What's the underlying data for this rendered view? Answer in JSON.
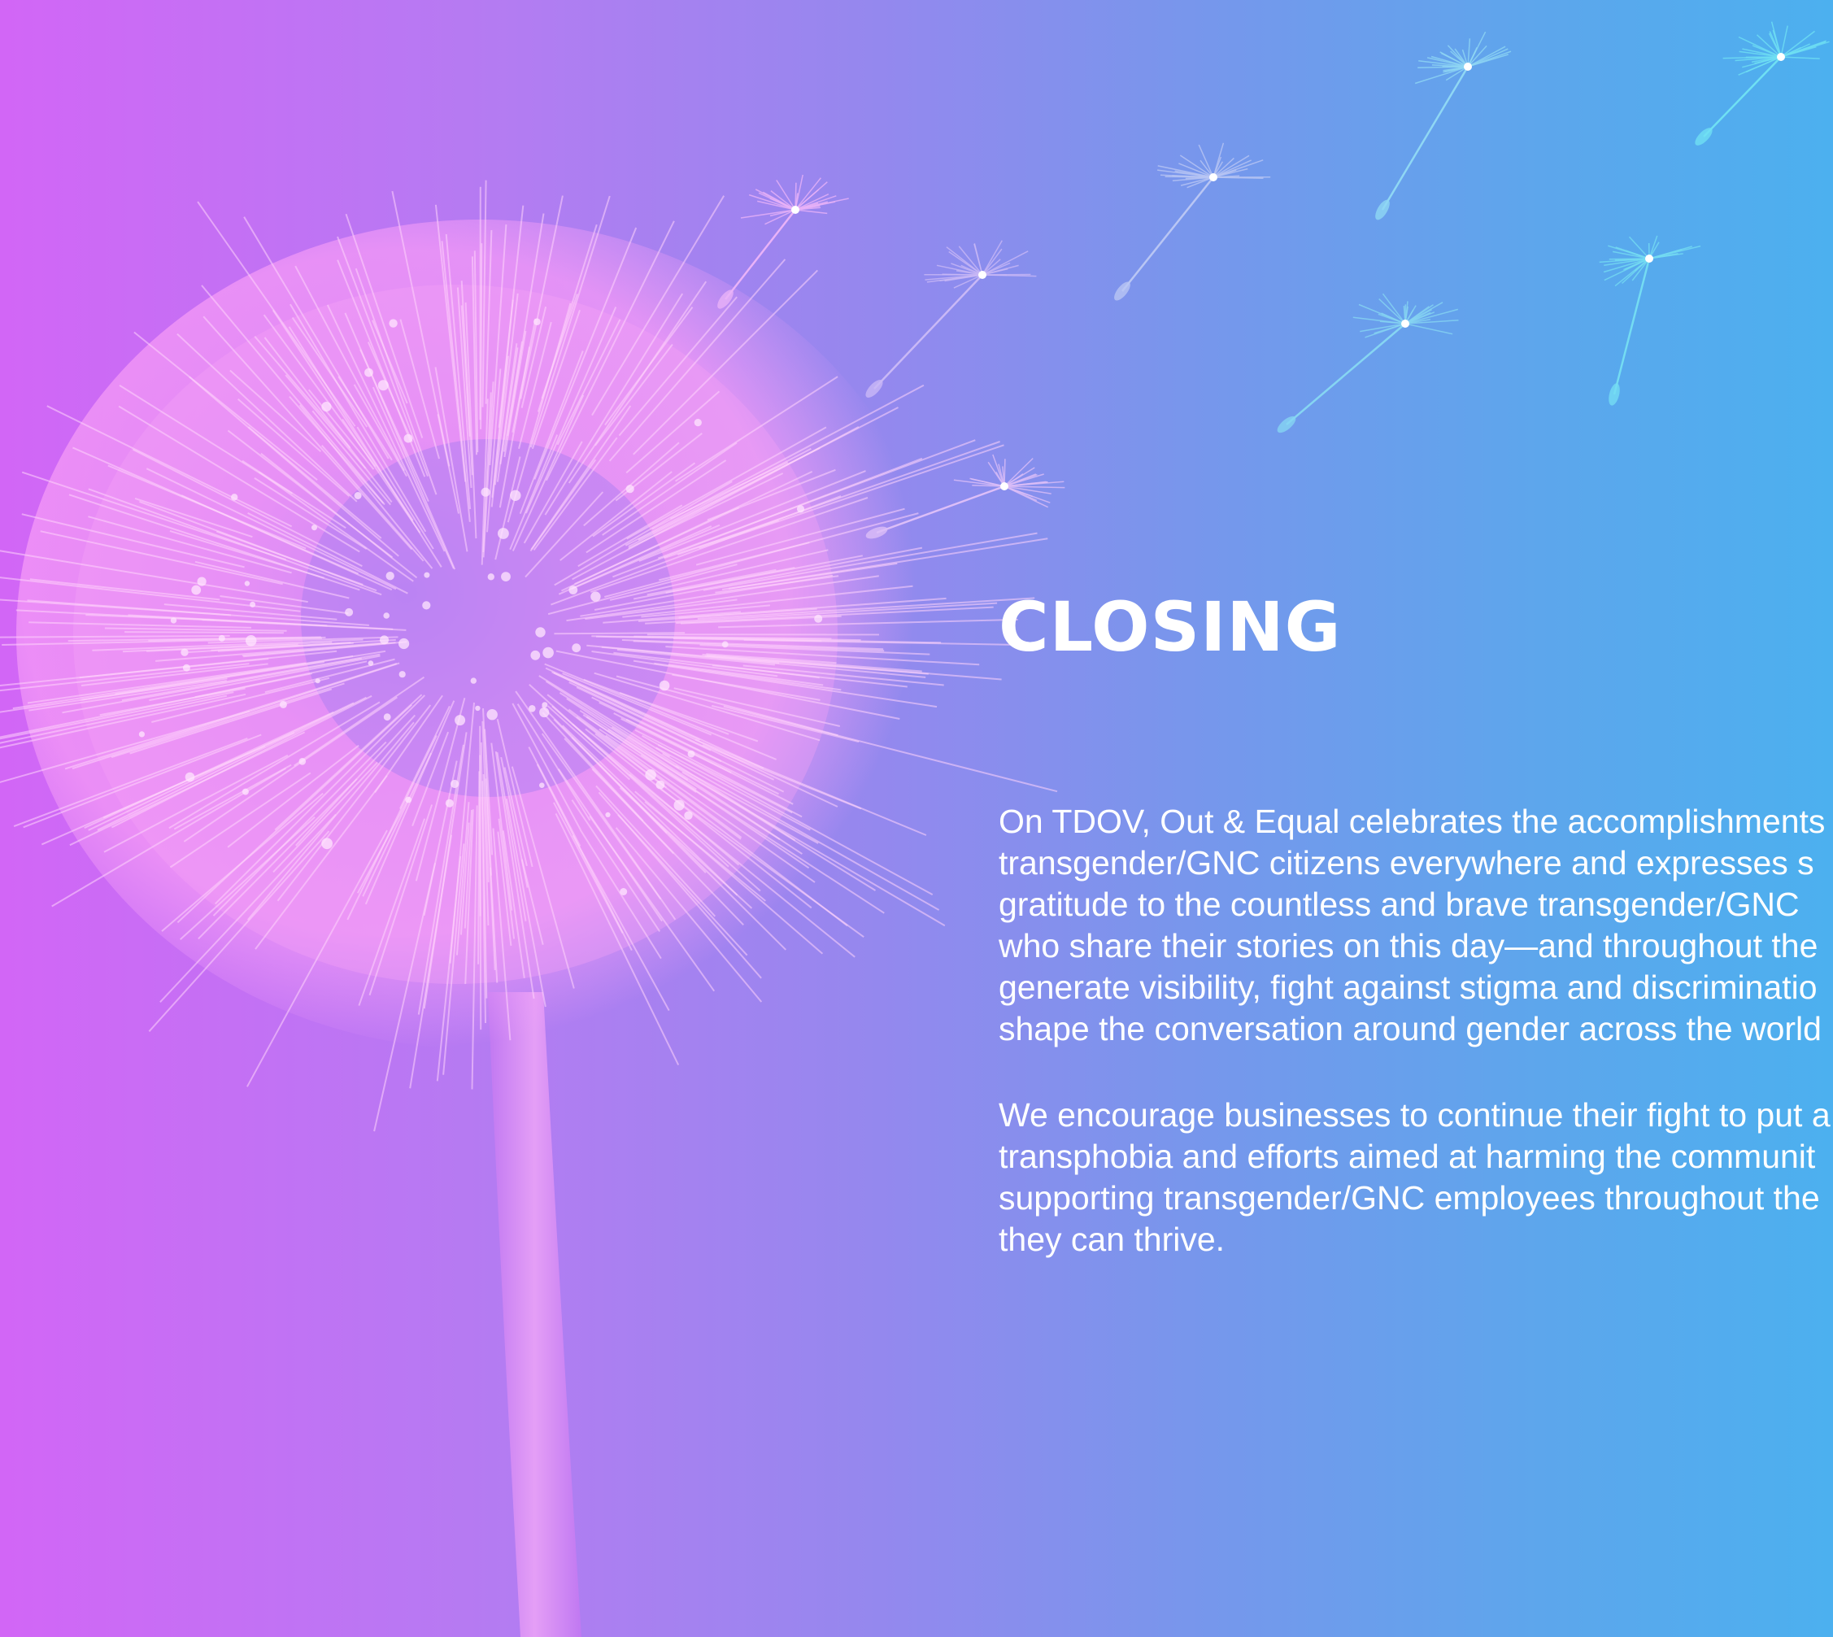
{
  "title": "CLOSING",
  "paragraphs": [
    {
      "lines": [
        "On TDOV, Out & Equal celebrates the accomplishments",
        "transgender/GNC citizens everywhere and expresses s",
        "gratitude to the countless and brave transgender/GNC",
        "who share their stories on this day—and throughout the",
        "generate visibility, fight against stigma and discriminatio",
        "shape the conversation around gender across the world"
      ]
    },
    {
      "lines": [
        "We encourage businesses to continue their fight to put a",
        "transphobia and efforts aimed at harming the communit",
        "supporting transgender/GNC employees throughout the",
        "they can thrive."
      ]
    }
  ],
  "colors": {
    "gradient_left": "#d266f6",
    "gradient_right": "#4cb0ef",
    "text": "#ffffff",
    "dandelion_pink": "#f79af7",
    "seed_cyan": "#5fe0f2"
  },
  "illustration": {
    "subject": "dandelion-icon",
    "seeds": "dandelion-seed-icon"
  }
}
